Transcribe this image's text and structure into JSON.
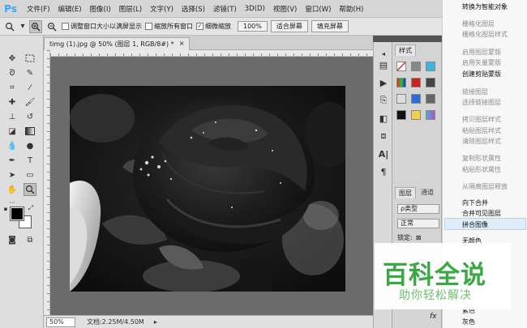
{
  "app": {
    "logo": "Ps"
  },
  "menubar": {
    "items": [
      "文件(F)",
      "编辑(E)",
      "图像(I)",
      "图层(L)",
      "文字(Y)",
      "选择(S)",
      "滤镜(T)",
      "3D(D)",
      "视图(V)",
      "窗口(W)",
      "帮助(H)"
    ]
  },
  "options": {
    "resize_windows": "调整窗口大小以满屏显示",
    "zoom_all": "缩放所有窗口",
    "scrubby_zoom": "细微缩放",
    "zoom_100": "100%",
    "fit_screen": "适合屏幕",
    "fill_screen": "填充屏幕"
  },
  "document": {
    "tab_title": "timg (1).jpg @ 50% (图层 1, RGB/8#) *",
    "close_glyph": "×"
  },
  "status": {
    "zoom": "50%",
    "doc_info": "文档:2.25M/4.50M"
  },
  "styles_panel": {
    "tab": "样式"
  },
  "layers_panel": {
    "tab_layers": "图层",
    "tab_channels": "通道",
    "filter_kind": "ρ类型",
    "blend_mode": "正常",
    "lock_label": "锁定:",
    "fx_label": "fx"
  },
  "context_menu": {
    "items": [
      {
        "label": "转换为智能对象",
        "enabled": true
      },
      {
        "label": "栅格化图层",
        "enabled": false
      },
      {
        "label": "栅格化图层样式",
        "enabled": false
      },
      {
        "label": "启用图层蒙版",
        "enabled": false
      },
      {
        "label": "启用矢量蒙版",
        "enabled": false
      },
      {
        "label": "创建剪贴蒙版",
        "enabled": true
      },
      {
        "label": "链接图层",
        "enabled": false
      },
      {
        "label": "选择链接图层",
        "enabled": false
      },
      {
        "label": "拷贝图层样式",
        "enabled": false
      },
      {
        "label": "粘贴图层样式",
        "enabled": false
      },
      {
        "label": "清除图层样式",
        "enabled": false
      },
      {
        "label": "复制形状属性",
        "enabled": false
      },
      {
        "label": "粘贴形状属性",
        "enabled": false
      },
      {
        "label": "从隔离图层释放",
        "enabled": false
      },
      {
        "label": "向下合并",
        "enabled": true
      },
      {
        "label": "合并可见图层",
        "enabled": true
      },
      {
        "label": "拼合图像",
        "enabled": true,
        "highlighted": true
      },
      {
        "label": "无颜色",
        "enabled": true
      },
      {
        "label": "紫色",
        "enabled": true
      },
      {
        "label": "灰色",
        "enabled": true
      }
    ]
  },
  "watermark": {
    "main": "百科全说",
    "sub": "助你轻松解决"
  }
}
